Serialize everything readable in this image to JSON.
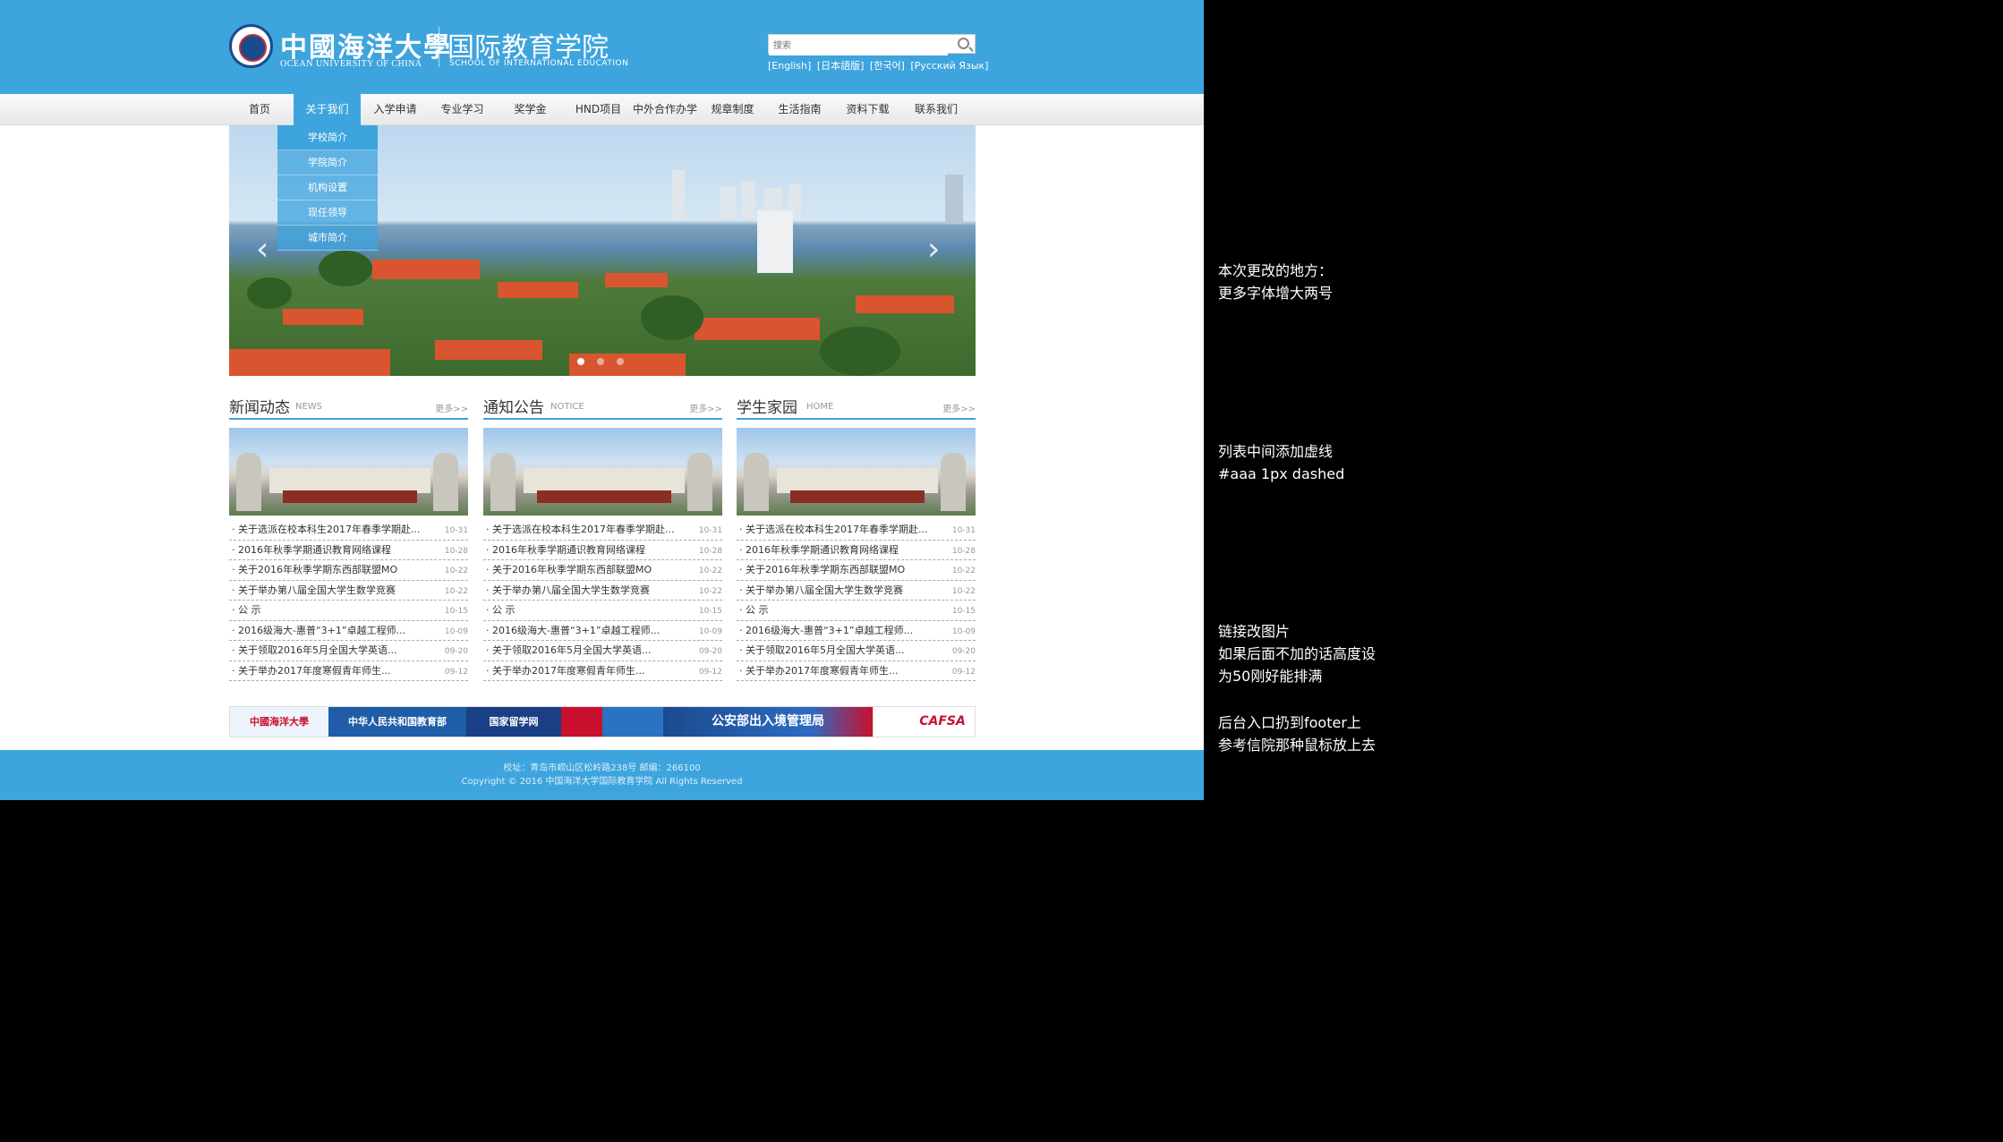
{
  "header": {
    "logo_cn": "中國海洋大學",
    "logo_en": "OCEAN UNIVERSITY OF CHINA",
    "school_cn": "国际教育学院",
    "school_en": "SCHOOL OF INTERNATIONAL EDUCATION",
    "search_placeholder": "搜索",
    "languages": [
      "[English]",
      "[日本語版]",
      "[한국어]",
      "[Русский Язык]"
    ]
  },
  "nav": {
    "items": [
      "首页",
      "关于我们",
      "入学申请",
      "专业学习",
      "奖学金",
      "HND项目",
      "中外合作办学",
      "规章制度",
      "生活指南",
      "资料下载",
      "联系我们"
    ],
    "active": "关于我们",
    "dropdown": [
      "学校简介",
      "学院简介",
      "机构设置",
      "现任领导",
      "城市简介"
    ]
  },
  "banner": {
    "prev_arrow": "‹",
    "next_arrow": "›",
    "slide_count": 3,
    "active_slide": 1
  },
  "columns": [
    {
      "title": "新闻动态",
      "subtitle": "NEWS",
      "more": "更多>>",
      "items": [
        {
          "text": "关于选派在校本科生2017年春季学期赴...",
          "date": "10-31"
        },
        {
          "text": "2016年秋季学期通识教育网络课程",
          "date": "10-28"
        },
        {
          "text": "关于2016年秋季学期东西部联盟MO",
          "date": "10-22"
        },
        {
          "text": "关于举办第八届全国大学生数学竞赛",
          "date": "10-22"
        },
        {
          "text": "公 示",
          "date": "10-15"
        },
        {
          "text": "2016级海大-惠普“3+1”卓越工程师...",
          "date": "10-09"
        },
        {
          "text": "关于领取2016年5月全国大学英语...",
          "date": "09-20"
        },
        {
          "text": "关于举办2017年度寒假青年师生...",
          "date": "09-12"
        }
      ]
    },
    {
      "title": "通知公告",
      "subtitle": "NOTICE",
      "more": "更多>>",
      "items": [
        {
          "text": "关于选派在校本科生2017年春季学期赴...",
          "date": "10-31"
        },
        {
          "text": "2016年秋季学期通识教育网络课程",
          "date": "10-28"
        },
        {
          "text": "关于2016年秋季学期东西部联盟MO",
          "date": "10-22"
        },
        {
          "text": "关于举办第八届全国大学生数学竞赛",
          "date": "10-22"
        },
        {
          "text": "公 示",
          "date": "10-15"
        },
        {
          "text": "2016级海大-惠普“3+1”卓越工程师...",
          "date": "10-09"
        },
        {
          "text": "关于领取2016年5月全国大学英语...",
          "date": "09-20"
        },
        {
          "text": "关于举办2017年度寒假青年师生...",
          "date": "09-12"
        }
      ]
    },
    {
      "title": "学生家园",
      "subtitle": "HOME",
      "more": "更多>>",
      "items": [
        {
          "text": "关于选派在校本科生2017年春季学期赴...",
          "date": "10-31"
        },
        {
          "text": "2016年秋季学期通识教育网络课程",
          "date": "10-28"
        },
        {
          "text": "关于2016年秋季学期东西部联盟MO",
          "date": "10-22"
        },
        {
          "text": "关于举办第八届全国大学生数学竞赛",
          "date": "10-22"
        },
        {
          "text": "公 示",
          "date": "10-15"
        },
        {
          "text": "2016级海大-惠普“3+1”卓越工程师...",
          "date": "10-09"
        },
        {
          "text": "关于领取2016年5月全国大学英语...",
          "date": "09-20"
        },
        {
          "text": "关于举办2017年度寒假青年师生...",
          "date": "09-12"
        }
      ]
    }
  ],
  "links": {
    "ouc": "中國海洋大學",
    "moe": "中华人民共和国教育部",
    "csc": "国家留学网",
    "mps": "公安部出入境管理局",
    "cafsa": "CAFSA"
  },
  "footer": {
    "address": "校址：青岛市崂山区松岭路238号  邮编：266100",
    "copyright": "Copyright © 2016 中国海洋大学国际教育学院  All Rights Reserved"
  },
  "notes": {
    "n1_l1": "本次更改的地方：",
    "n1_l2": "更多字体增大两号",
    "n2_l1": "列表中间添加虚线",
    "n2_l2": " #aaa 1px dashed",
    "n3_l1": "链接改图片",
    "n3_l2": "如果后面不加的话高度设",
    "n3_l3": "为50刚好能排满",
    "n4_l1": "后台入口扔到footer上",
    "n4_l2": "参考信院那种鼠标放上去"
  }
}
